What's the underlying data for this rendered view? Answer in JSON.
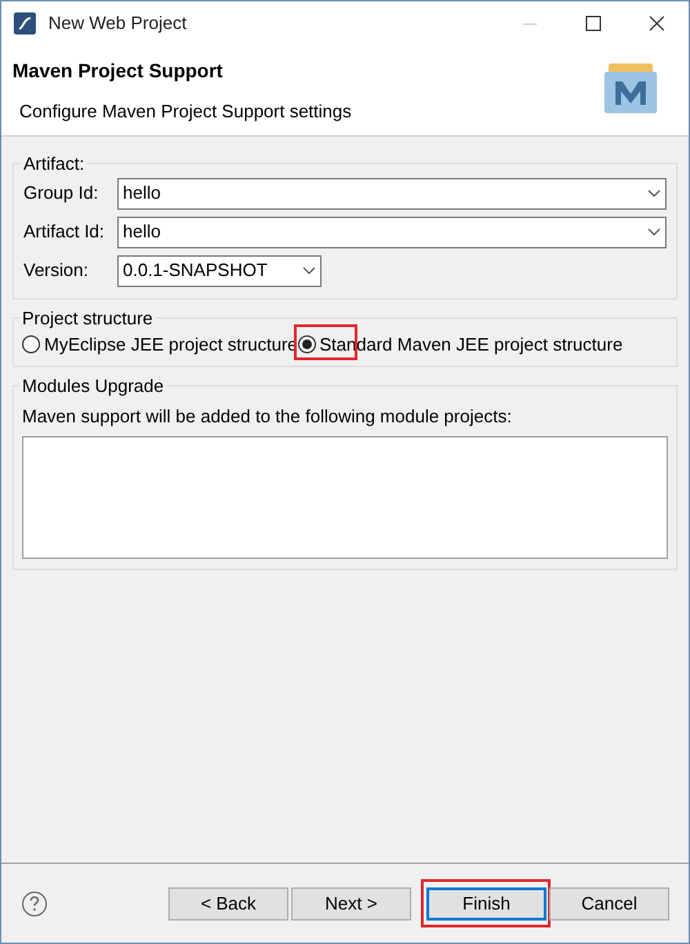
{
  "window": {
    "title": "New Web Project"
  },
  "header": {
    "title": "Maven Project Support",
    "subtitle": "Configure Maven Project Support settings"
  },
  "artifact": {
    "legend": "Artifact:",
    "fields": [
      {
        "label": "Group Id:",
        "value": "hello",
        "kind": "wide"
      },
      {
        "label": "Artifact Id:",
        "value": "hello",
        "kind": "wide"
      },
      {
        "label": "Version:",
        "value": "0.0.1-SNAPSHOT",
        "kind": "narrow"
      }
    ]
  },
  "project_structure": {
    "legend": "Project structure",
    "options": [
      {
        "label": "MyEclipse JEE project structure",
        "selected": false,
        "highlighted": false
      },
      {
        "label": "Standard Maven JEE project structure",
        "selected": true,
        "highlighted": true
      }
    ]
  },
  "modules_upgrade": {
    "legend": "Modules Upgrade",
    "description": "Maven support will be added to the following module projects:"
  },
  "buttons": [
    {
      "label": "< Back",
      "focused": false,
      "highlighted": false
    },
    {
      "label": "Next >",
      "focused": false,
      "highlighted": false
    },
    {
      "label": "Finish",
      "focused": true,
      "highlighted": true
    },
    {
      "label": "Cancel",
      "focused": false,
      "highlighted": false
    }
  ]
}
